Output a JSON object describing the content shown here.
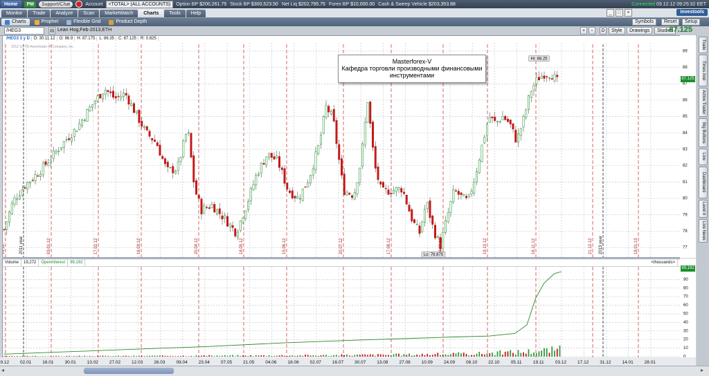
{
  "topbar": {
    "home": "Home",
    "pm": "PM",
    "support": "Support/Chat",
    "account_label": "Account",
    "account_value": "<TOTAL> (ALL ACCOUNTS)",
    "balances": [
      {
        "label": "Option BP",
        "value": "$200,261.75"
      },
      {
        "label": "Stock BP",
        "value": "$300,523.50"
      },
      {
        "label": "Net Liq",
        "value": "$202,795.75"
      },
      {
        "label": "Forex BP",
        "value": "$10,000.00"
      },
      {
        "label": "Cash & Sweep Vehicle",
        "value": "$203,353.88"
      }
    ],
    "connected": "Connected",
    "datetime": "03.12.12 09:25:32 EET"
  },
  "tabs": [
    "Monitor",
    "Trade",
    "Analyze",
    "Scan",
    "MarketWatch",
    "Charts",
    "Tools",
    "Help"
  ],
  "active_tab": "Charts",
  "brand": "investools",
  "subtabs": [
    "Charts",
    "Prophet",
    "Flexible Grid",
    "Product Depth"
  ],
  "toolbar": {
    "symbol": "/HEG3",
    "description": "Lean Hog,Feb-2013,ETH",
    "d_button": "D",
    "style": "Style",
    "drawings": "Drawings",
    "studies": "Studies",
    "last_price": "87.125",
    "symbols_btn": "Symbols",
    "reset_btn": "Reset",
    "setup_btn": "Setup"
  },
  "price_header": {
    "symbol_period": "/HEG3 3 y D",
    "date": "D: 30.11.12",
    "open": "O: 86.9",
    "high": "H: 87.175",
    "low": "L: 86.35",
    "close": "C: 87.125",
    "range": "R: 0.825",
    "copyright": "2012 (c) TD Ameritrade IP Company, Inc."
  },
  "note": {
    "line1": "Masterforex-V",
    "line2": "Кафедра торговли производными финансовыми",
    "line3": "инструментами"
  },
  "volume_header": {
    "volume_label": "Volume",
    "volume_value": "19,272",
    "oi_label": "OpenInterest",
    "oi_value": "99,192",
    "units": "<thousands>"
  },
  "sidebar": [
    "Trade",
    "Times And Sales",
    "Active Trader",
    "Big Buttons",
    "Live",
    "Dashboard",
    "Level II",
    "Live News"
  ],
  "chart_data": [
    {
      "type": "candlestick",
      "y_ticks": [
        "77",
        "78",
        "79",
        "80",
        "81",
        "82",
        "83",
        "84",
        "85",
        "86",
        "87",
        "88",
        "89"
      ],
      "ylim": [
        76.5,
        89.5
      ],
      "last_price": "87.125",
      "high_label": "Hi: 88.25",
      "low_label": "Lo: 76.875",
      "x_ticks": [
        "19.12",
        "02.01",
        "16.01",
        "30.01",
        "13.02",
        "27.02",
        "12.03",
        "26.03",
        "09.04",
        "23.04",
        "07.05",
        "21.05",
        "04.06",
        "18.06",
        "02.07",
        "16.07",
        "30.07",
        "13.08",
        "27.08",
        "10.09",
        "24.09",
        "08.10",
        "22.10",
        "05.11",
        "19.11",
        "03.12",
        "17.12",
        "31.12",
        "14.01",
        "28.01"
      ],
      "period_markers": [
        "19.12",
        "2011 year",
        "03.01.12",
        "17.02.12",
        "16.03.12",
        "20.04.12",
        "18.05.12",
        "15.06.12",
        "20.07.12",
        "17.08.12",
        "14.09.12",
        "19.10.12",
        "16.11.12",
        "21.12.12",
        "2013 year",
        "18.01.13"
      ],
      "close_path": [
        [
          0,
          78.1
        ],
        [
          5,
          79.8
        ],
        [
          12,
          80.8
        ],
        [
          20,
          81.6
        ],
        [
          28,
          82.6
        ],
        [
          35,
          83.5
        ],
        [
          42,
          84.3
        ],
        [
          50,
          85.6
        ],
        [
          58,
          86.7
        ],
        [
          64,
          86.1
        ],
        [
          70,
          86.4
        ],
        [
          76,
          85.2
        ],
        [
          82,
          84.0
        ],
        [
          88,
          83.4
        ],
        [
          94,
          81.7
        ],
        [
          100,
          81.8
        ],
        [
          106,
          84.3
        ],
        [
          110,
          80.6
        ],
        [
          114,
          79.3
        ],
        [
          120,
          79.6
        ],
        [
          128,
          78.7
        ],
        [
          134,
          77.9
        ],
        [
          140,
          79.6
        ],
        [
          146,
          81.5
        ],
        [
          152,
          82.7
        ],
        [
          158,
          82.3
        ],
        [
          164,
          80.5
        ],
        [
          170,
          80.0
        ],
        [
          176,
          81.2
        ],
        [
          182,
          83.3
        ],
        [
          186,
          85.6
        ],
        [
          190,
          84.9
        ],
        [
          196,
          80.5
        ],
        [
          202,
          80.2
        ],
        [
          206,
          82.2
        ],
        [
          210,
          86.0
        ],
        [
          214,
          82.0
        ],
        [
          218,
          80.4
        ],
        [
          224,
          80.5
        ],
        [
          230,
          80.6
        ],
        [
          236,
          78.6
        ],
        [
          240,
          77.9
        ],
        [
          244,
          79.8
        ],
        [
          248,
          78.1
        ],
        [
          252,
          77.1
        ],
        [
          256,
          78.9
        ],
        [
          260,
          80.5
        ],
        [
          264,
          80.1
        ],
        [
          268,
          79.8
        ],
        [
          272,
          81.3
        ],
        [
          276,
          83.2
        ],
        [
          280,
          85.0
        ],
        [
          284,
          84.6
        ],
        [
          288,
          85.0
        ],
        [
          292,
          84.6
        ],
        [
          296,
          83.5
        ],
        [
          300,
          84.8
        ],
        [
          304,
          86.5
        ],
        [
          308,
          87.3
        ],
        [
          312,
          87.6
        ],
        [
          316,
          87.6
        ],
        [
          320,
          87.1
        ]
      ]
    },
    {
      "type": "bar+line",
      "y_ticks": [
        "0",
        "10",
        "20",
        "30",
        "40",
        "50",
        "60",
        "70",
        "80",
        "90"
      ],
      "ylim": [
        0,
        100
      ],
      "oi_last": "99,192",
      "open_interest": [
        [
          0,
          3
        ],
        [
          40,
          6
        ],
        [
          80,
          9
        ],
        [
          120,
          12
        ],
        [
          160,
          16
        ],
        [
          200,
          19
        ],
        [
          230,
          21
        ],
        [
          260,
          23
        ],
        [
          280,
          24
        ],
        [
          295,
          27
        ],
        [
          302,
          37
        ],
        [
          307,
          68
        ],
        [
          312,
          86
        ],
        [
          318,
          97
        ],
        [
          322,
          99.2
        ]
      ],
      "volume_levels": [
        [
          0,
          0.6
        ],
        [
          60,
          0.9
        ],
        [
          120,
          1.3
        ],
        [
          180,
          1.8
        ],
        [
          230,
          2.6
        ],
        [
          270,
          3.8
        ],
        [
          300,
          6.5
        ],
        [
          322,
          9.5
        ]
      ]
    }
  ]
}
